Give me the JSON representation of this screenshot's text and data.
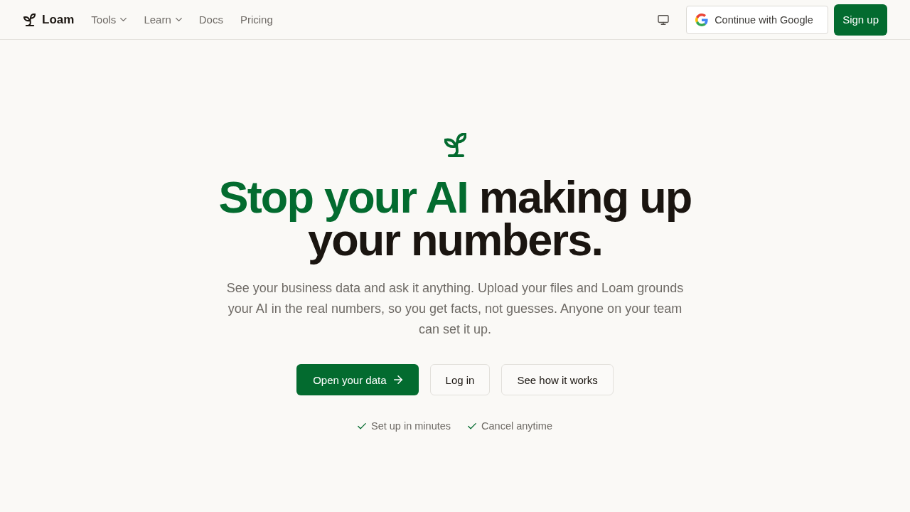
{
  "nav": {
    "brand": "Loam",
    "links": [
      {
        "label": "Tools",
        "kind": "menu"
      },
      {
        "label": "Learn",
        "kind": "menu"
      },
      {
        "label": "Docs",
        "kind": "link"
      },
      {
        "label": "Pricing",
        "kind": "link"
      }
    ],
    "google_button": "Continue with Google",
    "signup_button": "Sign up"
  },
  "hero": {
    "title": [
      {
        "text": "Stop your AI",
        "accent": true
      },
      {
        "text": "making up your numbers.",
        "accent": false
      }
    ],
    "lead": "See your business data and ask it anything. Upload your files and Loam grounds your AI in the real numbers, so you get facts, not guesses. Anyone on your team can set it up.",
    "buttons": [
      {
        "label": "Open your data",
        "kind": "primary"
      },
      {
        "label": "Log in",
        "kind": "secondary"
      },
      {
        "label": "See how it works",
        "kind": "secondary"
      }
    ],
    "perks": [
      "Set up in minutes",
      "Cancel anytime"
    ]
  }
}
